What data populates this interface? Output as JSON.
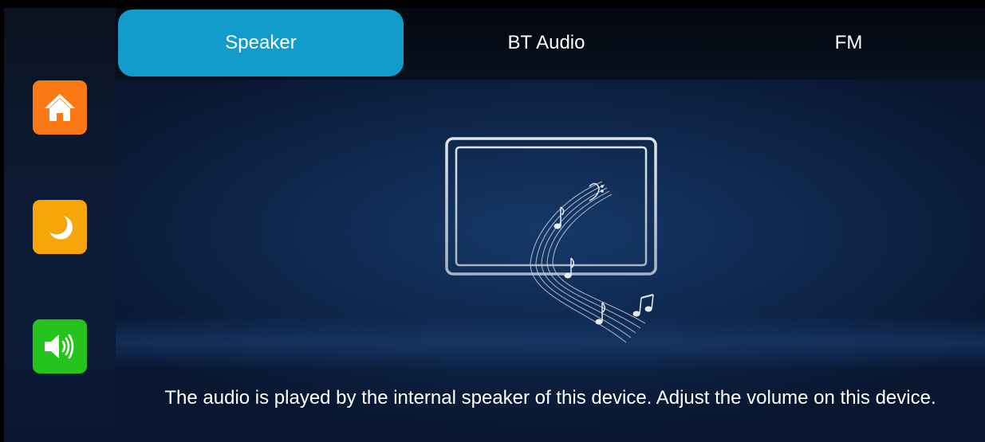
{
  "sidebar": {
    "items": [
      {
        "icon": "home-icon",
        "color": "#fb7a16"
      },
      {
        "icon": "moon-icon",
        "color": "#f6a60b"
      },
      {
        "icon": "speaker-icon",
        "color": "#24c41d"
      }
    ]
  },
  "tabs": {
    "speaker": "Speaker",
    "bt_audio": "BT Audio",
    "fm": "FM",
    "active_color": "#129ccc"
  },
  "main": {
    "description": "The audio is played by the internal speaker of this device. Adjust the volume on this device."
  }
}
